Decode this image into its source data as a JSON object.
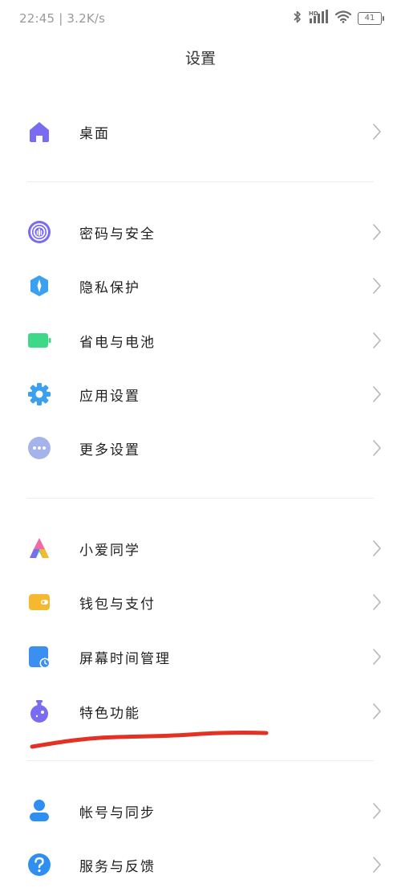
{
  "status_bar": {
    "time_speed": "22:45 | 3.2K/s",
    "network_badge": "HD",
    "battery_level": "41",
    "icons": [
      "bluetooth-icon",
      "signal-icon",
      "wifi-icon",
      "battery-icon"
    ]
  },
  "header": {
    "title": "设置"
  },
  "settings": {
    "desktop": "桌面",
    "password_security": "密码与安全",
    "privacy": "隐私保护",
    "battery": "省电与电池",
    "app_settings": "应用设置",
    "more_settings": "更多设置",
    "xiaoai": "小爱同学",
    "wallet": "钱包与支付",
    "screen_time": "屏幕时间管理",
    "special_features": "特色功能",
    "account_sync": "帐号与同步",
    "service_feedback": "服务与反馈"
  },
  "colors": {
    "desktop": "#7a6cf0",
    "password_security": "#7a6cf0",
    "privacy": "#3aa0ef",
    "battery": "#3fd889",
    "app_settings": "#3aa0ef",
    "more_settings": "#a4b4ea",
    "wallet": "#f5b82e",
    "screen_time": "#3a8ff0",
    "special_features": "#7a6cf0",
    "account_sync": "#2f8ff0",
    "service_feedback": "#2f8ff0",
    "annotation": "#e33224"
  }
}
